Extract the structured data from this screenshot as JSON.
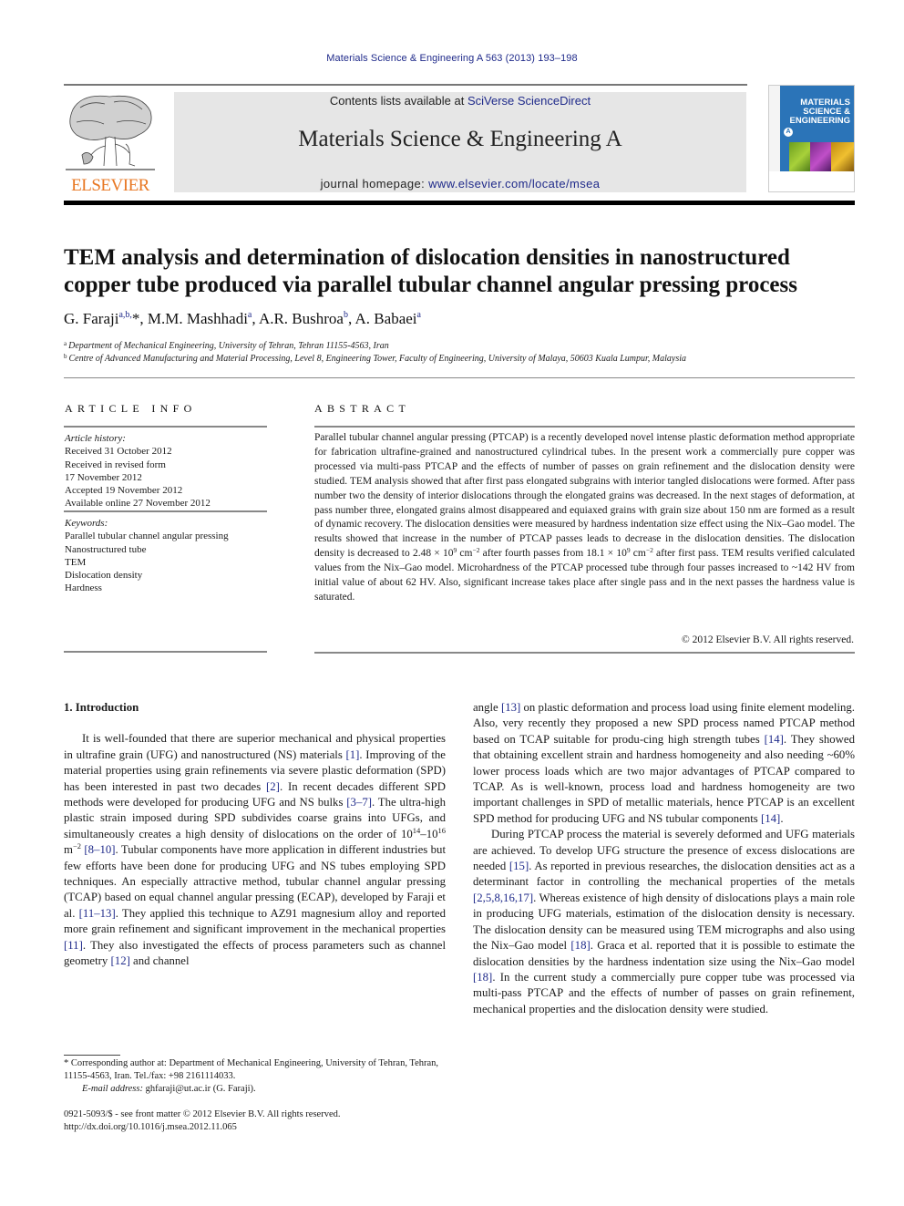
{
  "running_head": "Materials Science & Engineering A 563 (2013) 193–198",
  "header": {
    "publisher_logo_text": "ELSEVIER",
    "contents_prefix": "Contents lists available at ",
    "contents_link": "SciVerse ScienceDirect",
    "journal_title": "Materials Science & Engineering A",
    "homepage_prefix": "journal homepage: ",
    "homepage_link": "www.elsevier.com/locate/msea",
    "cover": {
      "line1": "MATERIALS",
      "line2": "SCIENCE &",
      "line3": "ENGINEERING",
      "badge": "A",
      "accent_color": "#2b74b8"
    },
    "logo_color": "#e87722",
    "link_color": "#1f2a8a"
  },
  "article": {
    "title": "TEM analysis and determination of dislocation densities in nanostructured copper tube produced via parallel tubular channel angular pressing process",
    "authors": [
      {
        "name": "G. Faraji",
        "sup": "a,b,",
        "star": "*"
      },
      {
        "name": "M.M. Mashhadi",
        "sup": "a"
      },
      {
        "name": "A.R. Bushroa",
        "sup": "b"
      },
      {
        "name": "A. Babaei",
        "sup": "a"
      }
    ],
    "affiliations": [
      {
        "mark": "a",
        "text": "Department of Mechanical Engineering, University of Tehran, Tehran 11155-4563, Iran"
      },
      {
        "mark": "b",
        "text": "Centre of Advanced Manufacturing and Material Processing, Level 8, Engineering Tower, Faculty of Engineering, University of Malaya, 50603 Kuala Lumpur, Malaysia"
      }
    ]
  },
  "article_info": {
    "heading": "ARTICLE INFO",
    "history_label": "Article history:",
    "history": [
      "Received 31 October 2012",
      "Received in revised form",
      "17 November 2012",
      "Accepted 19 November 2012",
      "Available online 27 November 2012"
    ],
    "keywords_label": "Keywords:",
    "keywords": [
      "Parallel tubular channel angular pressing",
      "Nanostructured tube",
      "TEM",
      "Dislocation density",
      "Hardness"
    ]
  },
  "abstract": {
    "heading": "ABSTRACT",
    "part1": "Parallel tubular channel angular pressing (PTCAP) is a recently developed novel intense plastic deformation method appropriate for fabrication ultrafine-grained and nanostructured cylindrical tubes. In the present work a commercially pure copper was processed via multi-pass PTCAP and the effects of number of passes on grain refinement and the dislocation density were studied. TEM analysis showed that after first pass elongated subgrains with interior tangled dislocations were formed. After pass number two the density of interior dislocations through the elongated grains was decreased. In the next stages of deformation, at pass number three, elongated grains almost disappeared and equiaxed grains with grain size about 150 nm are formed as a result of dynamic recovery. The dislocation densities were measured by hardness indentation size effect using the Nix–Gao model. The results showed that increase in the number of PTCAP passes leads to decrease in the dislocation densities. The dislocation density is decreased to 2.48 × 10",
    "sup1": "9",
    "part2": " cm",
    "sup2": "−2",
    "part3": " after fourth passes from 18.1 × 10",
    "sup3": "9",
    "part4": " cm",
    "sup4": "−2",
    "part5": " after first pass. TEM results verified calculated values from the Nix–Gao model. Microhardness of the PTCAP processed tube through four passes increased to ~142 HV from initial value of about 62 HV. Also, significant increase takes place after single pass and in the next passes the hardness value is saturated.",
    "copyright": "© 2012 Elsevier B.V. All rights reserved."
  },
  "body": {
    "section_heading": "1.  Introduction",
    "left": {
      "p1_a": "It is well-founded that there are superior mechanical and physical properties in ultrafine grain (UFG) and nanostructured (NS) materials ",
      "ref1": "[1]",
      "p1_b": ". Improving of the material properties using grain refinements via severe plastic deformation (SPD) has been interested in past two decades ",
      "ref2": "[2]",
      "p1_c": ". In recent decades different SPD methods were developed for producing UFG and NS bulks ",
      "ref3": "[3–7]",
      "p1_d": ". The ultra-high plastic strain imposed during SPD subdivides coarse grains into UFGs, and simultaneously creates a high density of dislocations on the order of 10",
      "sup_a": "14",
      "p1_e": "–10",
      "sup_b": "16",
      "p1_f": " m",
      "sup_c": "−2",
      "ref4": "[8–10]",
      "p1_g": ". Tubular components have more application in different industries but few efforts have been done for producing UFG and NS tubes employing SPD techniques. An especially attractive method, tubular channel angular pressing (TCAP) based on equal channel angular pressing (ECAP), developed by Faraji et al. ",
      "ref5": "[11–13]",
      "p1_h": ". They applied this technique to AZ91 magnesium alloy and reported more grain refinement and significant improvement in the mechanical properties ",
      "ref6": "[11]",
      "p1_i": ". They also investigated the effects of process parameters such as channel geometry ",
      "ref7": "[12]",
      "p1_j": " and channel"
    },
    "right": {
      "p1_a": "angle ",
      "ref1": "[13]",
      "p1_b": " on plastic deformation and process load using finite element modeling. Also, very recently they proposed a new SPD process named PTCAP method based on TCAP suitable for produ-cing high strength tubes ",
      "ref2": "[14]",
      "p1_c": ". They showed that obtaining excellent strain and hardness homogeneity and also needing ~60% lower process loads which are two major advantages of PTCAP compared to TCAP. As is well-known, process load and hardness homogeneity are two important challenges in SPD of metallic materials, hence PTCAP is an excellent SPD method for producing UFG and NS tubular components ",
      "ref3": "[14]",
      "p1_d": ".",
      "p2_a": "During PTCAP process the material is severely deformed and UFG materials are achieved. To develop UFG structure the presence of excess dislocations are needed ",
      "ref4": "[15]",
      "p2_b": ". As reported in previous researches, the dislocation densities act as a determinant factor in controlling the mechanical properties of the metals ",
      "ref5": "[2,5,8,16,17]",
      "p2_c": ". Whereas existence of high density of dislocations plays a main role in producing UFG materials, estimation of the dislocation density is necessary. The dislocation density can be measured using TEM micrographs and also using the Nix–Gao model ",
      "ref6": "[18]",
      "p2_d": ". Graca et al. reported that it is possible to estimate the dislocation densities by the hardness indentation size using the Nix–Gao model ",
      "ref7": "[18]",
      "p2_e": ". In the current study a commercially pure copper tube was processed via multi-pass PTCAP and the effects of number of passes on grain refinement, mechanical properties and the dislocation density were studied."
    }
  },
  "footnote": {
    "corresponding": "* Corresponding author at: Department of Mechanical Engineering, University of Tehran, Tehran, 11155-4563, Iran. Tel./fax: +98 2161114033.",
    "email_label": "E-mail address:",
    "email": " ghfaraji@ut.ac.ir (G. Faraji)."
  },
  "issn_line": "0921-5093/$ - see front matter © 2012 Elsevier B.V. All rights reserved.",
  "doi": "http://dx.doi.org/10.1016/j.msea.2012.11.065"
}
